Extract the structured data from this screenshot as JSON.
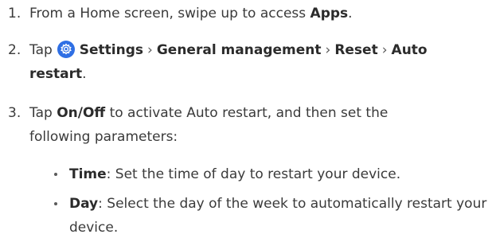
{
  "steps": [
    {
      "num": "1.",
      "pre": "From a Home screen, swipe up to access ",
      "b1": "Apps",
      "post": "."
    },
    {
      "num": "2.",
      "pre": "Tap",
      "icon": "settings-gear-icon",
      "b1": "Settings",
      "sep1": "›",
      "b2": "General management",
      "sep2": "›",
      "b3": "Reset",
      "sep3": "›",
      "b4": "Auto restart",
      "post": "."
    },
    {
      "num": "3.",
      "pre": "Tap ",
      "b1": "On/Off",
      "post": " to activate Auto restart, and then set the following parameters:"
    }
  ],
  "bullets": [
    {
      "label": "Time",
      "text": ": Set the time of day to restart your device."
    },
    {
      "label": "Day",
      "text": ": Select the day of the week to automatically restart your device."
    }
  ],
  "colors": {
    "icon_blue": "#2f6fe4",
    "text": "#3a3a3a"
  }
}
